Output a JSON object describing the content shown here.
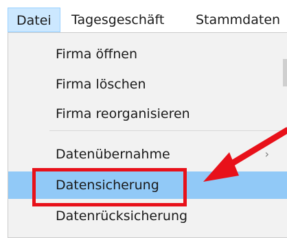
{
  "menubar": {
    "items": [
      {
        "label": "Datei"
      },
      {
        "label": "Tagesgeschäft"
      },
      {
        "label": "Stammdaten"
      }
    ]
  },
  "dropdown": {
    "items": [
      {
        "label": "Firma öffnen"
      },
      {
        "label": "Firma löschen"
      },
      {
        "label": "Firma reorganisieren"
      },
      {
        "label": "Datenübernahme"
      },
      {
        "label": "Datensicherung"
      },
      {
        "label": "Datenrücksicherung"
      }
    ]
  },
  "colors": {
    "highlight": "#e8111a",
    "hover": "#91c9f7",
    "active_menu": "#cce8ff"
  },
  "icons": {
    "submenu": "chevron-right-icon",
    "annotation": "red-arrow-icon"
  }
}
